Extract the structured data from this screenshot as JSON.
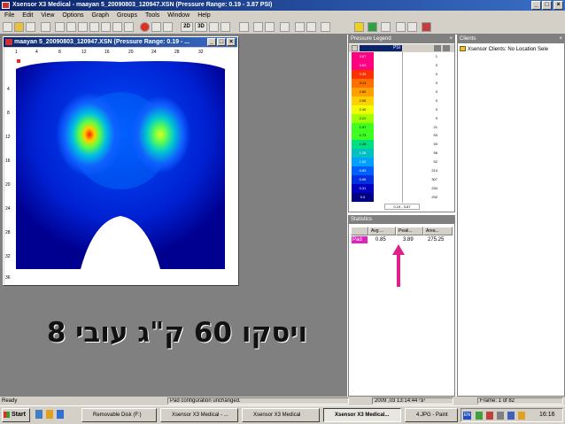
{
  "app_title": "Xsensor X3 Medical - maayan 5_20090803_120947.XSN  (Pressure Range: 0.19 - 3.87 PSI)",
  "menu": [
    "File",
    "Edit",
    "View",
    "Options",
    "Graph",
    "Groups",
    "Tools",
    "Window",
    "Help"
  ],
  "toolbar": {
    "btn_2d": "2D",
    "btn_3d": "3D"
  },
  "plot_window": {
    "title": "maayan 5_20090803_120947.XSN  (Pressure Range: 0.19 - ...",
    "x_ticks": [
      "1",
      "4",
      "8",
      "12",
      "16",
      "20",
      "24",
      "28",
      "32"
    ],
    "y_ticks": [
      "4",
      "8",
      "12",
      "16",
      "20",
      "24",
      "28",
      "32",
      "36"
    ]
  },
  "hebrew_caption": "ויסקו 60 ק\"ג עובי 8",
  "pressure_legend": {
    "title": "Pressure Legend",
    "unit": "PSI",
    "colors": [
      "#ff0080",
      "#ff3000",
      "#ff7000",
      "#ffa000",
      "#ffd000",
      "#f0ff00",
      "#a0ff00",
      "#40ff20",
      "#00e080",
      "#00c0c0",
      "#00a0ff",
      "#0060ff",
      "#0030e0",
      "#0000c0",
      "#000080"
    ],
    "values": [
      "3.87",
      "3.63",
      "3.38",
      "3.14",
      "2.89",
      "2.65",
      "2.40",
      "2.21",
      "1.97",
      "1.73",
      "1.48",
      "1.26",
      "1.02",
      "0.83",
      "0.65",
      "0.31",
      "0.0"
    ],
    "counts": [
      "1",
      "0",
      "0",
      "0",
      "0",
      "0",
      "0",
      "9",
      "21",
      "53",
      "53",
      "56",
      "52",
      "213",
      "307",
      "234",
      "292"
    ],
    "range_label": "0.19 - 3.87"
  },
  "statistics": {
    "title": "Statistics",
    "columns": [
      "Avg ...",
      "Peak...",
      "Area..."
    ],
    "row_label": "Pad",
    "avg": "0.85",
    "peak": "3.89",
    "area": "275.25"
  },
  "clients": {
    "title": "Clients",
    "item": "Xsensor Clients: No Location Sele"
  },
  "status": {
    "ready": "Ready",
    "message": "Pad configuration unchanged.",
    "datetime": "2009 ,03 יוני 13:14:44",
    "frame": "Frame: 1 of 82"
  },
  "taskbar": {
    "start": "Start",
    "tasks": [
      "Removable Disk (F:)",
      "Xsensor X3 Medical - ...",
      "Xsensor X3 Medical",
      "Xsensor X3 Medical...",
      "4.JPG - Paint"
    ],
    "lang": "EN",
    "clock": "16:16"
  },
  "colors": {
    "title_bar": "#0a246a",
    "arrow": "#e0208a"
  }
}
